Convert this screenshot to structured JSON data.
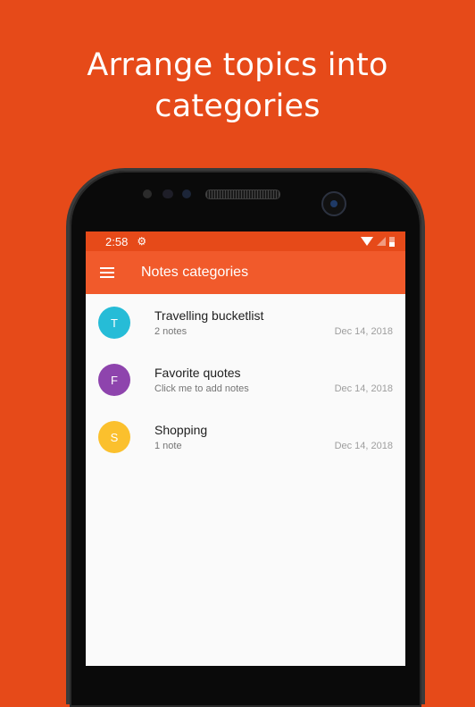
{
  "headline": {
    "line1": "Arrange topics into",
    "line2": "categories"
  },
  "status_bar": {
    "time": "2:58",
    "icons": [
      "gear-icon",
      "wifi-icon",
      "signal-icon",
      "battery-icon"
    ]
  },
  "app_bar": {
    "title": "Notes categories",
    "nav_icon": "menu-icon"
  },
  "colors": {
    "background": "#e64a19",
    "app_bar": "#f15a2b",
    "status_bar": "#e64a19"
  },
  "categories": [
    {
      "initial": "T",
      "title": "Travelling bucketlist",
      "subtitle": "2 notes",
      "date": "Dec 14, 2018",
      "color": "#26bcd7"
    },
    {
      "initial": "F",
      "title": "Favorite quotes",
      "subtitle": "Click me to add notes",
      "date": "Dec 14, 2018",
      "color": "#8e44ad"
    },
    {
      "initial": "S",
      "title": "Shopping",
      "subtitle": "1 note",
      "date": "Dec 14, 2018",
      "color": "#fbc02d"
    }
  ]
}
